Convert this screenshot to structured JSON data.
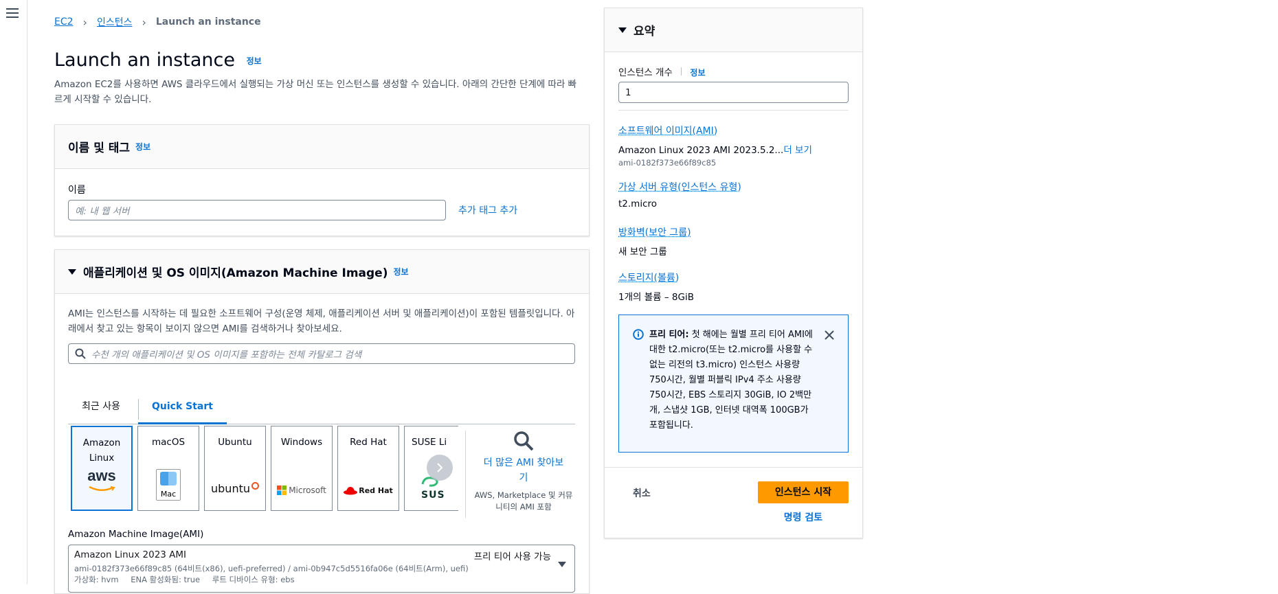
{
  "breadcrumb": {
    "items": [
      "EC2",
      "인스턴스"
    ],
    "current": "Launch an instance"
  },
  "page": {
    "title": "Launch an instance",
    "info": "정보",
    "description": "Amazon EC2를 사용하면 AWS 클라우드에서 실행되는 가상 머신 또는 인스턴스를 생성할 수 있습니다. 아래의 간단한 단계에 따라 빠르게 시작할 수 있습니다."
  },
  "name_tags": {
    "title": "이름 및 태그",
    "info": "정보",
    "name_label": "이름",
    "name_placeholder": "예: 내 웹 서버",
    "add_tags": "추가 태그 추가"
  },
  "ami_section": {
    "title": "애플리케이션 및 OS 이미지(Amazon Machine Image)",
    "info": "정보",
    "description": "AMI는 인스턴스를 시작하는 데 필요한 소프트웨어 구성(운영 체제, 애플리케이션 서버 및 애플리케이션)이 포함된 템플릿입니다. 아래에서 찾고 있는 항목이 보이지 않으면 AMI를 검색하거나 찾아보세요.",
    "search_placeholder": "수천 개의 애플리케이션 및 OS 이미지를 포함하는 전체 카탈로그 검색",
    "tabs": [
      "최근 사용",
      "Quick Start"
    ],
    "active_tab": "Quick Start",
    "tiles": [
      {
        "name": "Amazon Linux",
        "logo_text": "aws"
      },
      {
        "name": "macOS",
        "logo_text": "Mac"
      },
      {
        "name": "Ubuntu",
        "logo_text": "ubuntu"
      },
      {
        "name": "Windows",
        "logo_text": "Microsoft"
      },
      {
        "name": "Red Hat",
        "logo_text": "Red Hat"
      },
      {
        "name": "SUSE Li",
        "logo_text": "SUS"
      }
    ],
    "browse_more": "더 많은 AMI 찾아보기",
    "browse_more_sub": "AWS, Marketplace 및 커뮤니티의 AMI 포함",
    "ami_label": "Amazon Machine Image(AMI)",
    "ami_name": "Amazon Linux 2023 AMI",
    "ami_ids": "ami-0182f373e66f89c85 (64비트(x86), uefi-preferred) / ami-0b947c5d5516fa06e (64비트(Arm), uefi)",
    "ami_virt": "가상화: hvm",
    "ami_ena": "ENA 활성화됨: true",
    "ami_root": "루트 디바이스 유형: ebs",
    "free_tier_badge": "프리 티어 사용 가능"
  },
  "summary": {
    "title": "요약",
    "count_label": "인스턴스 개수",
    "info": "정보",
    "count_value": "1",
    "software_title": "소프트웨어 이미지(AMI)",
    "software_value": "Amazon Linux 2023 AMI 2023.5.2...",
    "software_more": "더 보기",
    "software_id": "ami-0182f373e66f89c85",
    "type_title": "가상 서버 유형(인스턴스 유형)",
    "type_value": "t2.micro",
    "firewall_title": "방화벽(보안 그룹)",
    "firewall_value": "새 보안 그룹",
    "storage_title": "스토리지(볼륨)",
    "storage_value": "1개의 볼륨 – 8GiB",
    "free_tier_bold": "프리 티어:",
    "free_tier_text": "첫 해에는 월별 프리 티어 AMI에 대한 t2.micro(또는 t2.micro를 사용할 수 없는 리전의 t3.micro) 인스턴스 사용량 750시간, 월별 퍼블릭 IPv4 주소 사용량 750시간, EBS 스토리지 30GiB, IO 2백만 개, 스냅샷 1GB, 인터넷 대역폭 100GB가 포함됩니다.",
    "cancel": "취소",
    "launch": "인스턴스 시작",
    "review": "명령 검토"
  },
  "colors": {
    "primary": "#0972d3",
    "launch_button": "#ff9900",
    "info_box_bg": "#f2f8fd"
  }
}
